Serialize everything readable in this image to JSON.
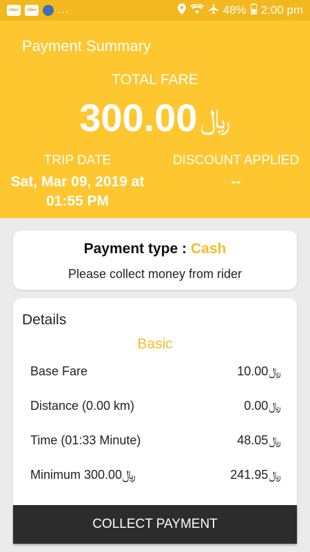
{
  "status_bar": {
    "app_icons": [
      "Uber",
      "Uber",
      "app"
    ],
    "overflow": "...",
    "battery": "48%",
    "time": "2:00 pm",
    "icons": [
      "location-icon",
      "wifi-icon",
      "airplane-icon",
      "battery-icon"
    ]
  },
  "header": {
    "title": "Payment Summary",
    "total_label": "TOTAL FARE",
    "total_amount": "300.00",
    "currency": "﷼",
    "trip_date_label": "TRIP DATE",
    "trip_date_value": "Sat, Mar 09, 2019 at 01:55 PM",
    "discount_label": "DISCOUNT APPLIED",
    "discount_value": "--"
  },
  "payment": {
    "type_label": "Payment type :",
    "type_value": "Cash",
    "note": "Please collect money from rider"
  },
  "details": {
    "title": "Details",
    "section": "Basic",
    "rows": [
      {
        "label": "Base Fare",
        "value": "10.00"
      },
      {
        "label": "Distance (0.00 km)",
        "value": "0.00"
      },
      {
        "label": "Time (01:33 Minute)",
        "value": "48.05"
      },
      {
        "label": "Minimum 300.00﷼",
        "value": "241.95"
      }
    ]
  },
  "footer": {
    "button_label": "COLLECT PAYMENT"
  },
  "colors": {
    "header_bg": "#fec72f",
    "status_bg": "#f3b81f",
    "accent": "#f5bd29",
    "button_bg": "#2c2c2c",
    "page_bg": "#ebebeb"
  }
}
